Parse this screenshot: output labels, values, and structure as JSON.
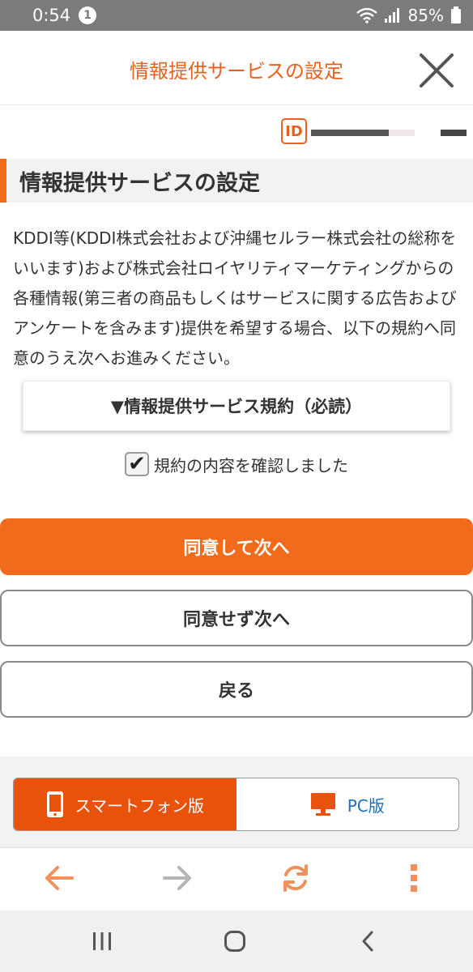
{
  "status_bar": {
    "time": "0:54",
    "notification_count": "1",
    "battery": "85%"
  },
  "header": {
    "title": "情報提供サービスの設定"
  },
  "id_badge": "ID",
  "section": {
    "title": "情報提供サービスの設定"
  },
  "description": "KDDI等(KDDI株式会社および沖縄セルラー株式会社の総称をいいます)および株式会社ロイヤリティマーケティングからの各種情報(第三者の商品もしくはサービスに関する広告およびアンケートを含みます)提供を希望する場合、以下の規約へ同意のうえ次へお進みください。",
  "terms": {
    "label": "▼情報提供サービス規約（必読）"
  },
  "confirm": {
    "checked": true,
    "label": "規約の内容を確認しました"
  },
  "buttons": {
    "agree": "同意して次へ",
    "disagree": "同意せず次へ",
    "back": "戻る"
  },
  "version_switch": {
    "smartphone": "スマートフォン版",
    "pc": "PC版",
    "active": "smartphone"
  },
  "colors": {
    "accent": "#f26b1d",
    "header_title": "#e8621f",
    "link_blue": "#1d6fb8"
  },
  "icons": {
    "close": "close-icon",
    "smartphone": "smartphone-icon",
    "pc": "monitor-icon",
    "back": "arrow-left-icon",
    "forward": "arrow-right-icon",
    "reload": "reload-icon",
    "menu": "more-vertical-icon"
  }
}
